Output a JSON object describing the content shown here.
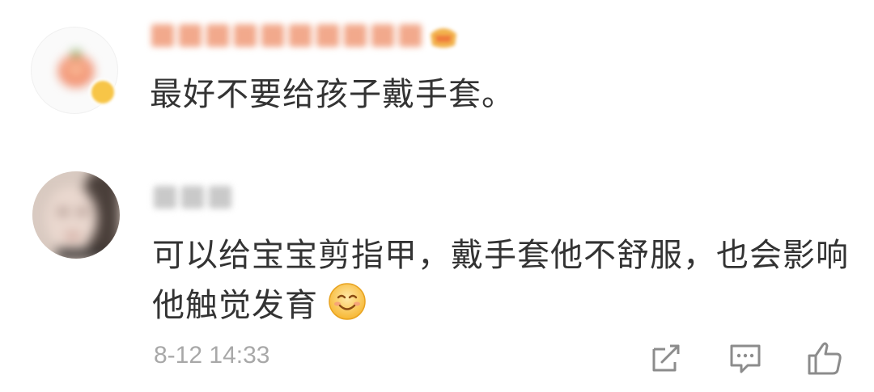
{
  "comments": [
    {
      "username": "",
      "text": "最好不要给孩子戴手套。"
    },
    {
      "username": "",
      "text": "可以给宝宝剪指甲，戴手套他不舒服，也会影响他触觉发育",
      "emoji": "smiling-face-emoji"
    }
  ],
  "footer": {
    "timestamp": "8-12 14:33",
    "actions": [
      "repost-icon",
      "reply-icon",
      "like-icon"
    ]
  },
  "colors": {
    "text": "#333333",
    "meta": "#a8a8a8",
    "icon": "#8c8c8c",
    "vip_badge": "#f7c547"
  }
}
